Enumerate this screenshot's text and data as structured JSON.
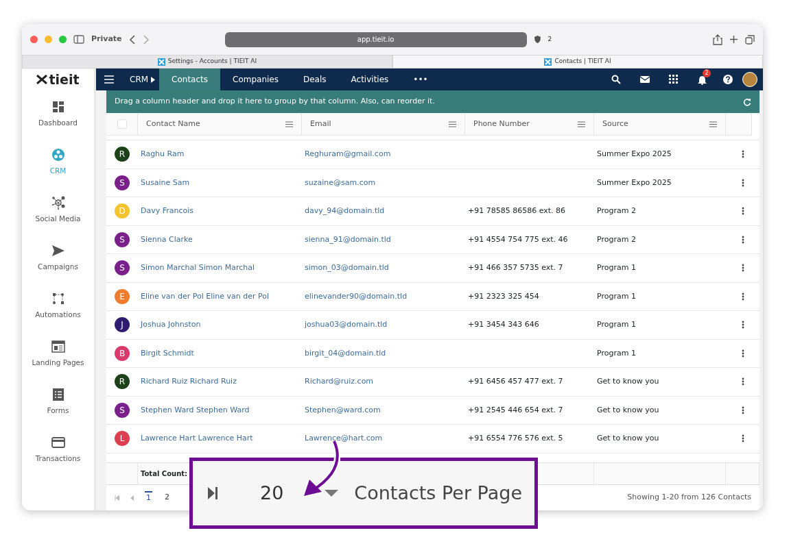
{
  "browser": {
    "private_label": "Private",
    "url": "app.tieit.io",
    "shield_count": "2",
    "tabs": [
      {
        "title": "Settings - Accounts | TIEIT AI",
        "selected": false
      },
      {
        "title": "Contacts | TIEIT AI",
        "selected": true
      }
    ]
  },
  "logo": "tieit",
  "sidebar": {
    "items": [
      {
        "kind": "dashboard",
        "label": "Dashboard",
        "selected": false
      },
      {
        "kind": "crm",
        "label": "CRM",
        "selected": true
      },
      {
        "kind": "social",
        "label": "Social Media",
        "selected": false
      },
      {
        "kind": "campaigns",
        "label": "Campaigns",
        "selected": false
      },
      {
        "kind": "automations",
        "label": "Automations",
        "selected": false
      },
      {
        "kind": "landing",
        "label": "Landing Pages",
        "selected": false
      },
      {
        "kind": "forms",
        "label": "Forms",
        "selected": false
      },
      {
        "kind": "transactions",
        "label": "Transactions",
        "selected": false
      }
    ]
  },
  "navbar": {
    "module": "CRM",
    "tabs": [
      {
        "label": "Contacts",
        "selected": true
      },
      {
        "label": "Companies",
        "selected": false
      },
      {
        "label": "Deals",
        "selected": false
      },
      {
        "label": "Activities",
        "selected": false
      }
    ],
    "more": "•••",
    "notification_count": "2"
  },
  "group_banner": "Drag a column header and drop it here to group by that column. Also, can reorder it.",
  "table": {
    "columns": [
      "Contact Name",
      "Email",
      "Phone Number",
      "Source"
    ],
    "rows": [
      {
        "initial": "R",
        "color": "#1d4219",
        "name": "Raghu Ram",
        "email": "Reghuram@gmail.com",
        "source": "Summer Expo 2025"
      },
      {
        "initial": "S",
        "color": "#7b1f8a",
        "name": "Susaine Sam",
        "email": "suzaine@sam.com",
        "source": "Summer Expo 2025"
      },
      {
        "initial": "D",
        "color": "#f4c430",
        "name": "Davy Francois",
        "email": "davy_94@domain.tld",
        "phone": "+91 78585 86586 ext. 86",
        "source": "Program 2"
      },
      {
        "initial": "S",
        "color": "#7b1f8a",
        "name": "Sienna Clarke",
        "email": "sienna_91@domain.tld",
        "phone": "+91 4554 754 775 ext. 46",
        "source": "Program 2"
      },
      {
        "initial": "S",
        "color": "#7b1f8a",
        "name": "Simon Marchal Simon Marchal",
        "email": "simon_03@domain.tld",
        "phone": "+91 466 357 5735 ext. 7",
        "source": "Program 1"
      },
      {
        "initial": "E",
        "color": "#ef7d2d",
        "name": "Eline van der Pol Eline van der Pol",
        "email": "elinevander90@domain.tld",
        "phone": "+91 2323 325 454",
        "source": "Program 1"
      },
      {
        "initial": "J",
        "color": "#2e1a6e",
        "name": "Joshua Johnston",
        "email": "joshua03@domain.tld",
        "phone": "+91 3454 343 646",
        "source": "Program 1"
      },
      {
        "initial": "B",
        "color": "#d63b6b",
        "name": "Birgit Schmidt",
        "email": "birgit_04@domain.tld",
        "source": "Program 1"
      },
      {
        "initial": "R",
        "color": "#1d4219",
        "name": "Richard Ruiz Richard Ruiz",
        "email": "Richard@ruiz.com",
        "phone": "+91 6456 457 477 ext. 7",
        "source": "Get to know you"
      },
      {
        "initial": "S",
        "color": "#7b1f8a",
        "name": "Stephen Ward Stephen Ward",
        "email": "Stephen@ward.com",
        "phone": "+91 2545 446 654 ext. 7",
        "source": "Get to know you"
      },
      {
        "initial": "L",
        "color": "#dc3f4f",
        "name": "Lawrence Hart Lawrence Hart",
        "email": "Lawrence@hart.com",
        "phone": "+91 6554 776 576 ext. 5",
        "source": "Get to know you"
      }
    ],
    "total_label": "Total Count:",
    "select_all_checked": false
  },
  "pager": {
    "pages": [
      {
        "label": "1",
        "selected": true
      },
      {
        "label": "2",
        "selected": false
      }
    ],
    "summary": "Showing 1-20 from 126 Contacts"
  },
  "callout": {
    "page_size": "20",
    "label": "Contacts Per Page"
  }
}
